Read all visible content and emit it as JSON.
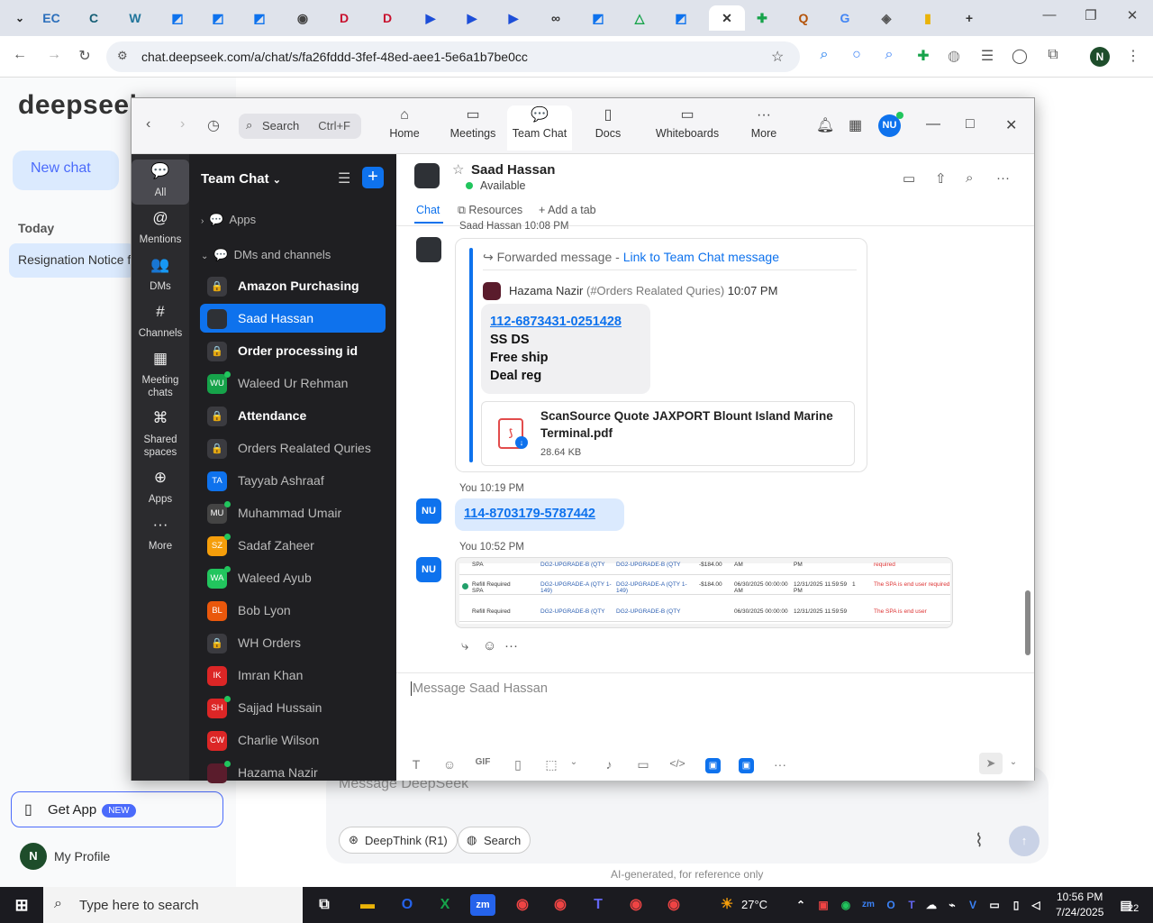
{
  "browser": {
    "url": "chat.deepseek.com/a/chat/s/fa26fddd-3fef-48ed-aee1-5e6a1b7be0cc",
    "profile_initial": "N",
    "tabs": [
      {
        "icon": "ec-icon",
        "glyph": "EC",
        "color": "#2a6ebb"
      },
      {
        "icon": "c-icon",
        "glyph": "C",
        "color": "#155e75"
      },
      {
        "icon": "wordpress-icon",
        "glyph": "W",
        "color": "#21759b"
      },
      {
        "icon": "doc-icon",
        "glyph": "◩",
        "color": "#0e72ed"
      },
      {
        "icon": "doc-icon",
        "glyph": "◩",
        "color": "#0e72ed"
      },
      {
        "icon": "doc-icon",
        "glyph": "◩",
        "color": "#0e72ed"
      },
      {
        "icon": "globe-icon",
        "glyph": "◉",
        "color": "#444"
      },
      {
        "icon": "dh-icon",
        "glyph": "D",
        "color": "#c8102e"
      },
      {
        "icon": "dh-icon",
        "glyph": "D",
        "color": "#c8102e"
      },
      {
        "icon": "play-icon",
        "glyph": "▶",
        "color": "#1d4ed8"
      },
      {
        "icon": "play-icon",
        "glyph": "▶",
        "color": "#1d4ed8"
      },
      {
        "icon": "play-icon",
        "glyph": "▶",
        "color": "#1d4ed8"
      },
      {
        "icon": "link-icon",
        "glyph": "∞",
        "color": "#333"
      },
      {
        "icon": "doc-icon",
        "glyph": "◩",
        "color": "#0e72ed"
      },
      {
        "icon": "drive-icon",
        "glyph": "△",
        "color": "#16a34a"
      },
      {
        "icon": "doc-icon",
        "glyph": "◩",
        "color": "#0e72ed"
      },
      {
        "icon": "close-icon",
        "glyph": "✕",
        "color": "#333"
      },
      {
        "icon": "sheets-icon",
        "glyph": "✚",
        "color": "#16a34a"
      },
      {
        "icon": "qw-icon",
        "glyph": "Q",
        "color": "#b45309"
      },
      {
        "icon": "google-icon",
        "glyph": "G",
        "color": "#4285f4"
      },
      {
        "icon": "shield-icon",
        "glyph": "◈",
        "color": "#555"
      },
      {
        "icon": "keep-icon",
        "glyph": "▮",
        "color": "#eab308"
      },
      {
        "icon": "new-tab-icon",
        "glyph": "+",
        "color": "#333"
      }
    ]
  },
  "deepseek": {
    "logo": "deepseek",
    "new_chat": "New chat",
    "today": "Today",
    "history_item": "Resignation Notice f",
    "get_app": "Get App",
    "new_badge": "NEW",
    "profile_initial": "N",
    "profile": "My Profile",
    "placeholder": "Message DeepSeek",
    "deepthink": "DeepThink (R1)",
    "search": "Search",
    "footer": "AI-generated, for reference only"
  },
  "zoom": {
    "search_label": "Search",
    "search_shortcut": "Ctrl+F",
    "tabs": [
      {
        "label": "Home",
        "icon": "home-icon",
        "glyph": "⌂"
      },
      {
        "label": "Meetings",
        "icon": "video-icon",
        "glyph": "▭"
      },
      {
        "label": "Team Chat",
        "icon": "chat-icon",
        "glyph": "💬"
      },
      {
        "label": "Docs",
        "icon": "docs-icon",
        "glyph": "▯"
      },
      {
        "label": "Whiteboards",
        "icon": "whiteboard-icon",
        "glyph": "▭"
      },
      {
        "label": "More",
        "icon": "more-icon",
        "glyph": "···"
      }
    ],
    "avatar_initials": "NU",
    "rail": [
      {
        "label": "All",
        "icon": "chat-icon",
        "glyph": "💬"
      },
      {
        "label": "Mentions",
        "icon": "at-icon",
        "glyph": "@"
      },
      {
        "label": "DMs",
        "icon": "people-icon",
        "glyph": "👥"
      },
      {
        "label": "Channels",
        "icon": "hash-icon",
        "glyph": "#"
      },
      {
        "label": "Meeting chats",
        "icon": "calendar-icon",
        "glyph": "▦"
      },
      {
        "label": "Shared spaces",
        "icon": "share-icon",
        "glyph": "⌘"
      },
      {
        "label": "Apps",
        "icon": "apps-icon",
        "glyph": "⊕"
      },
      {
        "label": "More",
        "icon": "more-icon",
        "glyph": "···"
      }
    ],
    "list_title": "Team Chat",
    "section_apps": "Apps",
    "section_dms": "DMs and channels",
    "channels": [
      {
        "name": "Amazon Purchasing",
        "avatar": "🔒",
        "type": "lock",
        "bold": true
      },
      {
        "name": "Saad Hassan",
        "avatar": "",
        "type": "photo",
        "selected": true
      },
      {
        "name": "Order processing id",
        "avatar": "🔒",
        "type": "lock",
        "bold": true
      },
      {
        "name": "Waleed Ur Rehman",
        "avatar": "WU",
        "color": "#16a34a",
        "online": true
      },
      {
        "name": "Attendance",
        "avatar": "🔒",
        "type": "lock",
        "bold": true
      },
      {
        "name": "Orders Realated Quries",
        "avatar": "🔒",
        "type": "lock"
      },
      {
        "name": "Tayyab Ashraaf",
        "avatar": "TA",
        "color": "#0e72ed"
      },
      {
        "name": "Muhammad Umair",
        "avatar": "MU",
        "color": "#444",
        "online": true
      },
      {
        "name": "Sadaf Zaheer",
        "avatar": "SZ",
        "color": "#f59e0b",
        "online": true
      },
      {
        "name": "Waleed Ayub",
        "avatar": "WA",
        "color": "#22c55e",
        "online": true
      },
      {
        "name": "Bob Lyon",
        "avatar": "BL",
        "color": "#ea580c"
      },
      {
        "name": "WH Orders",
        "avatar": "🔒",
        "type": "lock"
      },
      {
        "name": "Imran Khan",
        "avatar": "IK",
        "color": "#dc2626"
      },
      {
        "name": "Sajjad Hussain",
        "avatar": "SH",
        "color": "#dc2626",
        "online": true
      },
      {
        "name": "Charlie Wilson",
        "avatar": "CW",
        "color": "#dc2626"
      },
      {
        "name": "Hazama Nazir",
        "avatar": "",
        "color": "#5a1c2c",
        "online": true
      }
    ],
    "chat": {
      "name": "Saad Hassan",
      "status": "Available",
      "tab_chat": "Chat",
      "tab_resources": "Resources",
      "tab_add": "Add a tab",
      "msg1_meta": "Saad Hassan 10:08 PM",
      "forwarded": "Forwarded message",
      "forward_link": "Link to Team Chat message",
      "orig_sender": "Hazama Nazir",
      "orig_channel": "(#Orders Realated Quries)",
      "orig_time": "10:07 PM",
      "order_link": "112-6873431-0251428",
      "line1": "SS DS",
      "line2": "Free ship",
      "line3": "Deal reg",
      "file_name": "ScanSource Quote JAXPORT Blount Island Marine Terminal.pdf",
      "file_size": "28.64 KB",
      "msg2_meta": "You 10:19 PM",
      "msg2_link": "114-8703179-5787442",
      "msg3_meta": "You 10:52 PM",
      "my_initials": "NU",
      "compose_placeholder": "Message Saad Hassan"
    },
    "screenshot_rows": [
      [
        "SPA",
        "DG2-UPGRADE-B (QTY",
        "DG2-UPGRADE-B (QTY",
        "-$184.00",
        "AM",
        "PM",
        "",
        "required"
      ],
      [
        "Refill Required SPA",
        "DG2-UPGRADE-A (QTY 1-149)",
        "DG2-UPGRADE-A (QTY 1-149)",
        "-$184.00",
        "06/30/2025 00:00:00 AM",
        "12/31/2025 11:59:59 PM",
        "1",
        "The SPA is end user required"
      ],
      [
        "Refill Required",
        "DG2-UPGRADE-B (QTY",
        "DG2-UPGRADE-B (QTY",
        "",
        "06/30/2025 00:00:00",
        "12/31/2025 11:59:59",
        "",
        "The SPA is end user"
      ]
    ]
  },
  "taskbar": {
    "search": "Type here to search",
    "temp": "27°C",
    "time": "10:56 PM",
    "date": "7/24/2025",
    "notifications": "22"
  }
}
